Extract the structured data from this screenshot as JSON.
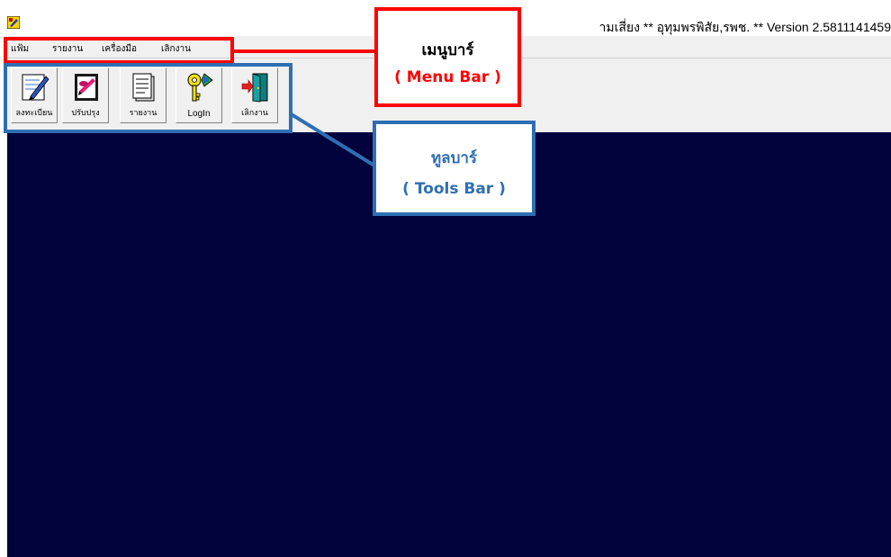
{
  "window": {
    "title": "ามเสี่ยง  ** อุทุมพรพิสัย,รพช. **  Version 2.5811141459"
  },
  "menu": {
    "items": [
      "แฟ้ม",
      "รายงาน",
      "เครื่องมือ",
      "เลิกงาน"
    ]
  },
  "toolbar": {
    "buttons": [
      {
        "label": "ลงทะเบียน",
        "icon": "register-icon"
      },
      {
        "label": "ปรับปรุง",
        "icon": "update-icon"
      },
      {
        "label": "รายงาน",
        "icon": "report-icon"
      },
      {
        "label": "LogIn",
        "icon": "key-icon"
      },
      {
        "label": "เลิกงาน",
        "icon": "exit-door-icon"
      }
    ]
  },
  "annotations": {
    "menubar": {
      "line1": "เมนูบาร์",
      "line2": "( Menu Bar )",
      "color": "#ff0000"
    },
    "toolbar": {
      "line1": "ทูลบาร์",
      "line2": "( Tools Bar )",
      "color": "#2e6fb3"
    }
  },
  "colors": {
    "workspace": "#02023d",
    "chrome": "#f0f0f0"
  }
}
